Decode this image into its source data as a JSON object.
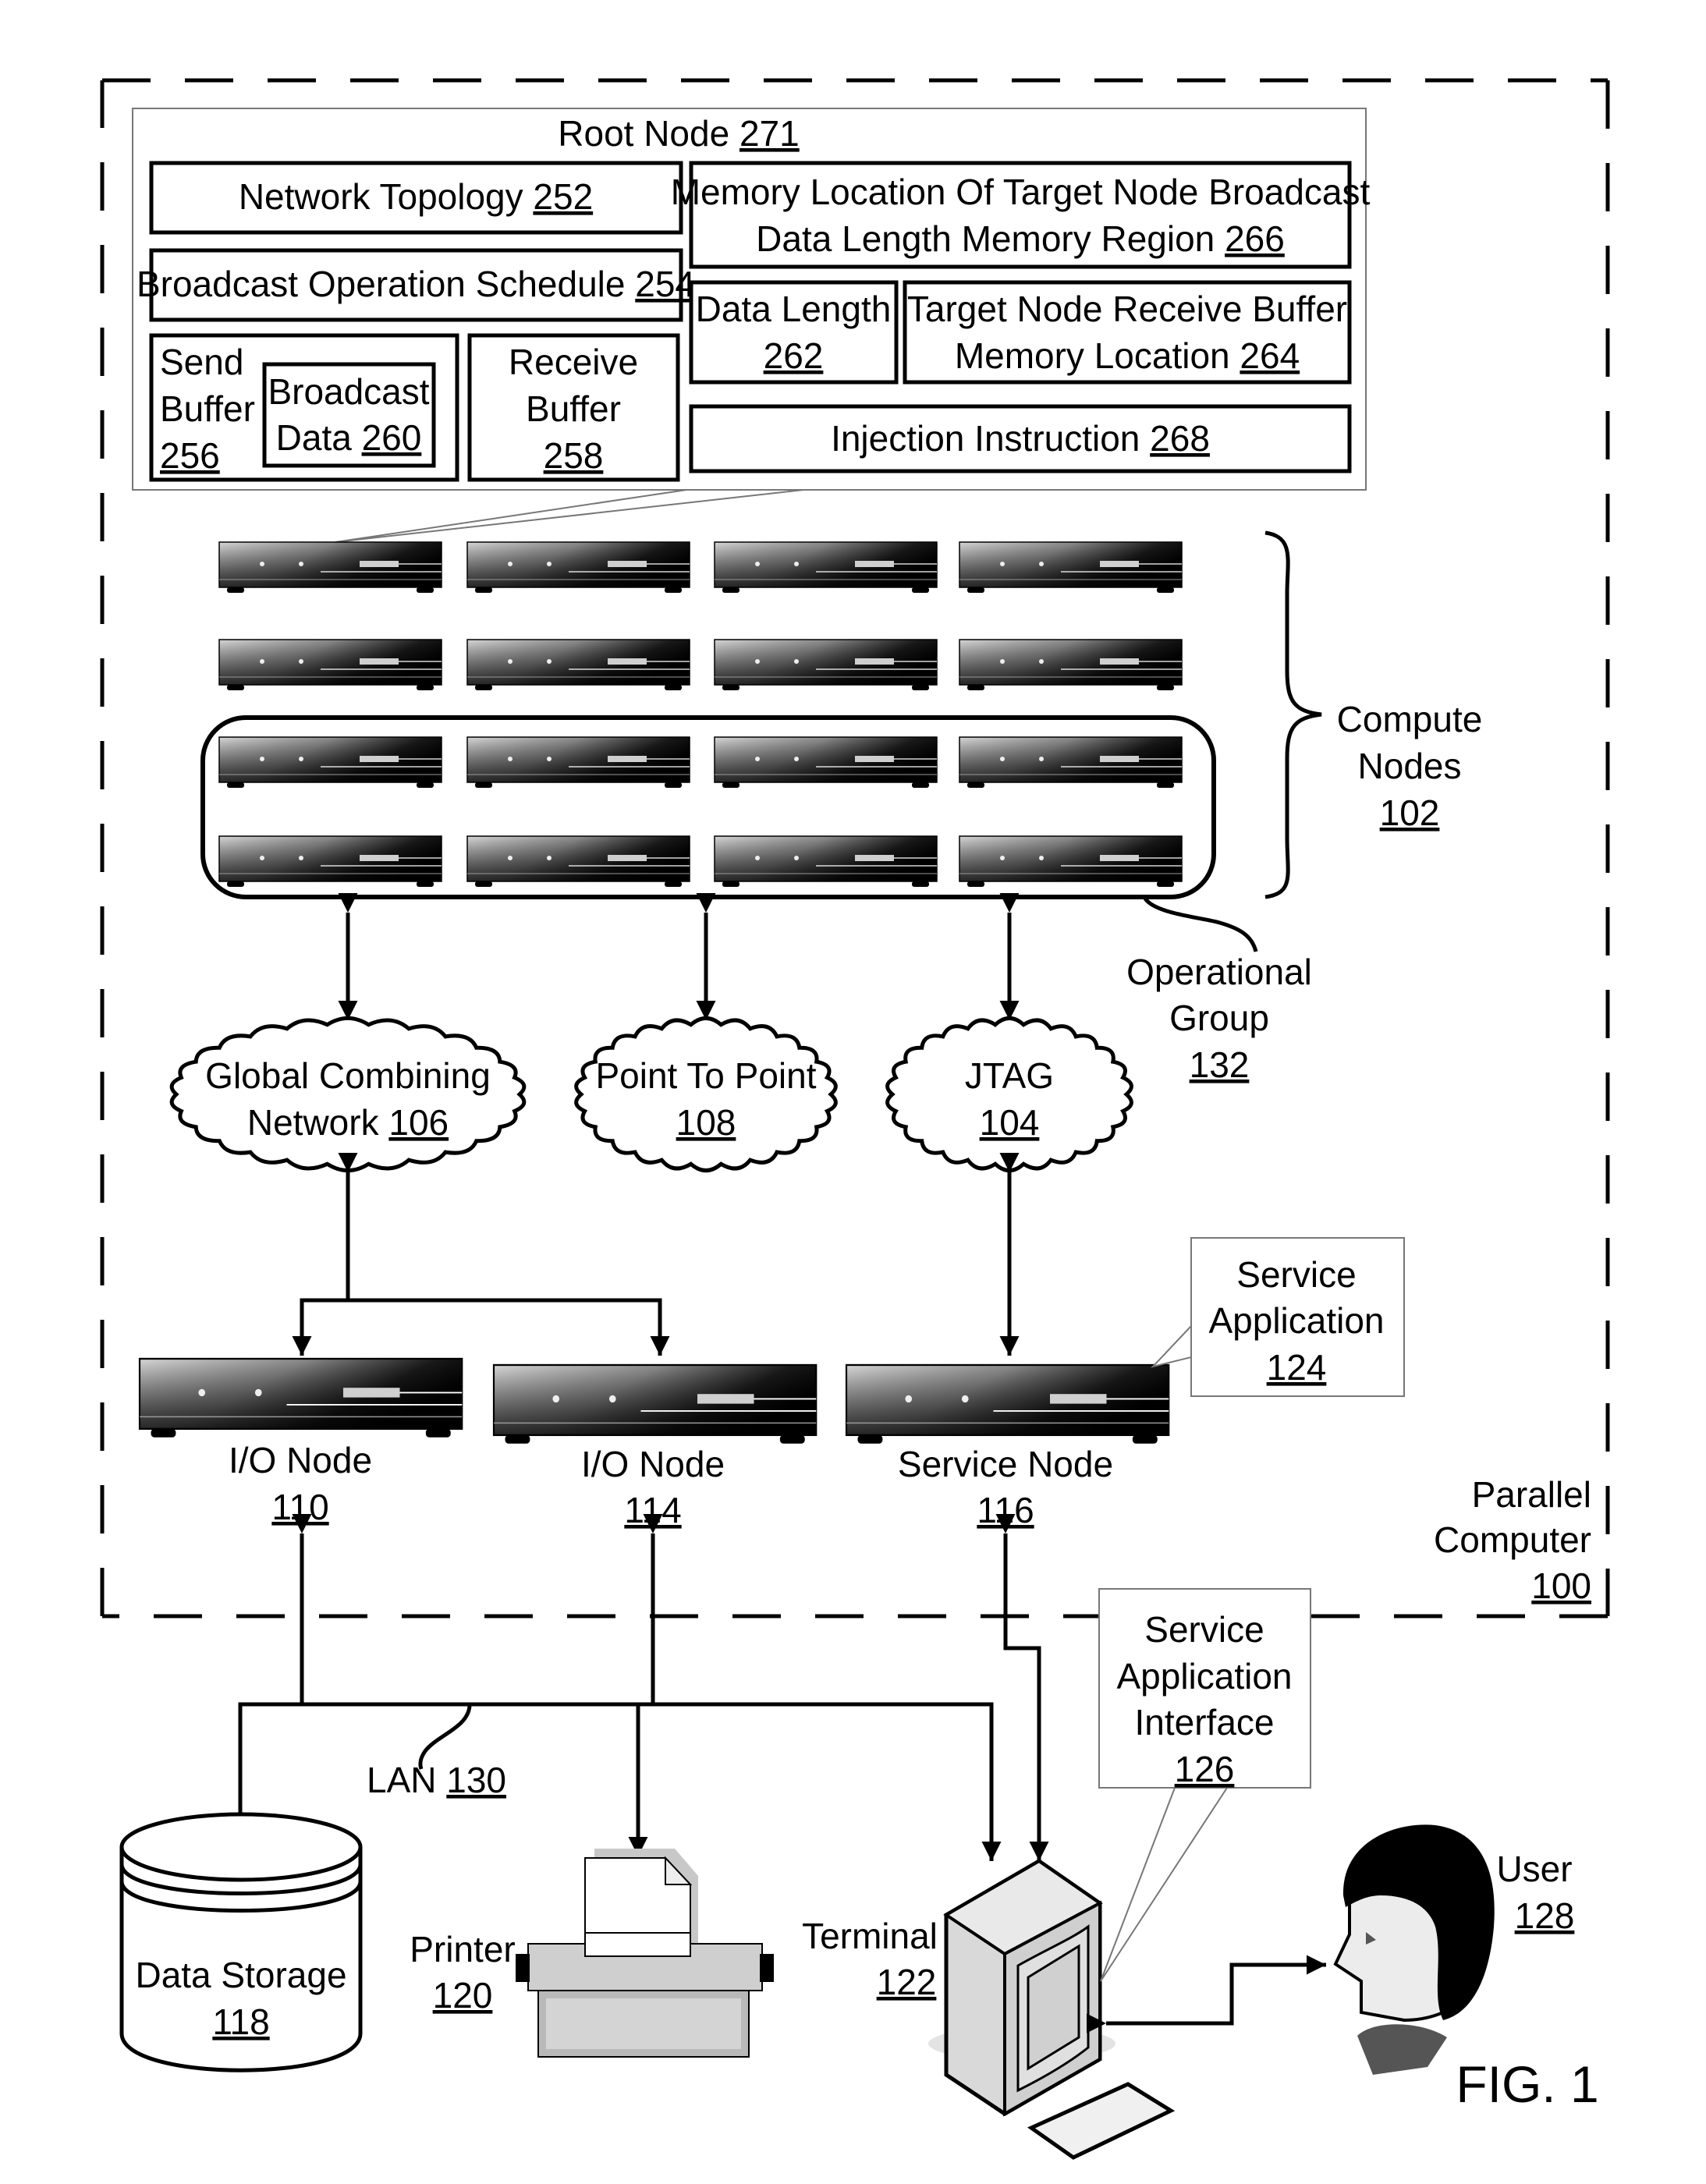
{
  "figure_label": "FIG. 1",
  "parallel_computer": {
    "label": "Parallel Computer",
    "line1": "Parallel",
    "line2": "Computer",
    "ref": "100"
  },
  "root_node": {
    "title": "Root Node",
    "ref": "271",
    "network_topology": {
      "label": "Network Topology",
      "ref": "252"
    },
    "broadcast_operation_schedule": {
      "label": "Broadcast Operation Schedule",
      "ref": "254"
    },
    "send_buffer": {
      "line1": "Send",
      "line2": "Buffer",
      "ref": "256"
    },
    "broadcast_data": {
      "line1": "Broadcast",
      "line2": "Data",
      "ref": "260"
    },
    "receive_buffer": {
      "line1": "Receive",
      "line2": "Buffer",
      "ref": "258"
    },
    "memory_location_region": {
      "line1": "Memory Location Of Target Node Broadcast",
      "line2": "Data Length Memory Region",
      "ref": "266"
    },
    "data_length": {
      "line1": "Data Length",
      "ref": "262"
    },
    "target_node_receive_buffer": {
      "line1": "Target Node Receive Buffer",
      "line2": "Memory Location",
      "ref": "264"
    },
    "injection_instruction": {
      "label": "Injection Instruction",
      "ref": "268"
    }
  },
  "compute_nodes": {
    "line1": "Compute",
    "line2": "Nodes",
    "ref": "102",
    "rows": 4,
    "columns": 4
  },
  "operational_group": {
    "line1": "Operational",
    "line2": "Group",
    "ref": "132"
  },
  "networks": [
    {
      "id": "global-combining-network",
      "line1": "Global Combining",
      "line2": "Network",
      "ref": "106"
    },
    {
      "id": "point-to-point",
      "line1": "Point To Point",
      "line2": "",
      "ref": "108"
    },
    {
      "id": "jtag",
      "line1": "JTAG",
      "line2": "",
      "ref": "104"
    }
  ],
  "io_nodes": [
    {
      "label": "I/O Node",
      "ref": "110"
    },
    {
      "label": "I/O Node",
      "ref": "114"
    }
  ],
  "service_node": {
    "label": "Service Node",
    "ref": "116"
  },
  "service_application": {
    "line1": "Service",
    "line2": "Application",
    "ref": "124"
  },
  "service_application_interface": {
    "line1": "Service",
    "line2": "Application",
    "line3": "Interface",
    "ref": "126"
  },
  "lan": {
    "label": "LAN",
    "ref": "130"
  },
  "data_storage": {
    "label": "Data Storage",
    "ref": "118"
  },
  "printer": {
    "label": "Printer",
    "ref": "120"
  },
  "terminal": {
    "label": "Terminal",
    "ref": "122"
  },
  "user": {
    "label": "User",
    "ref": "128"
  }
}
